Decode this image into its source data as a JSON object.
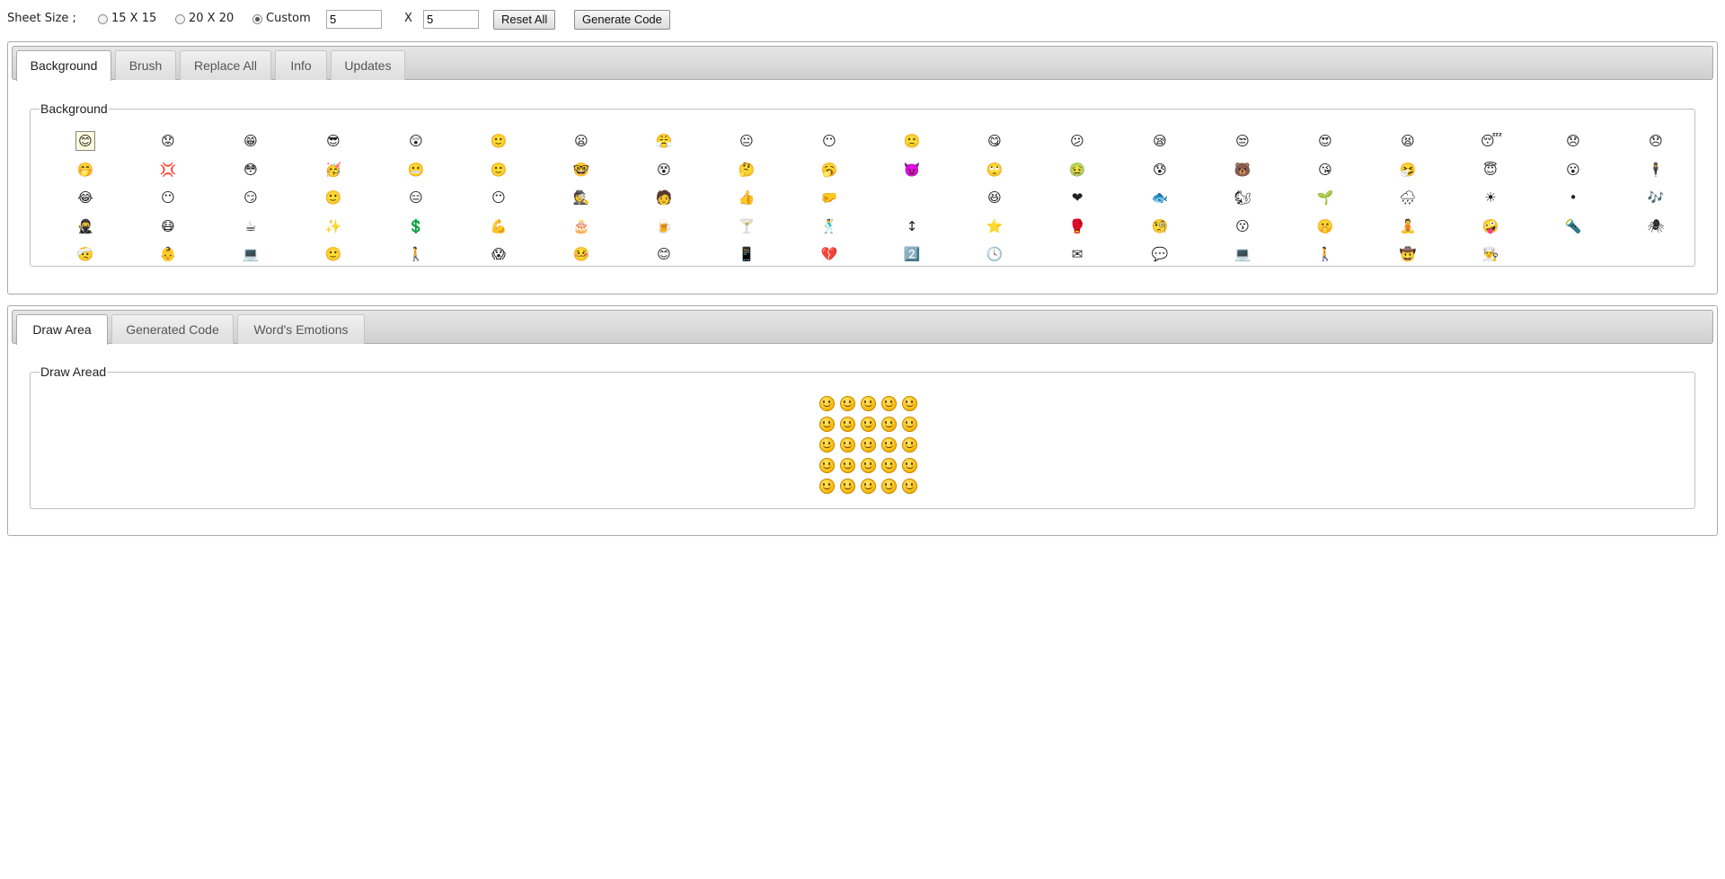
{
  "toolbar": {
    "sheet_size_label": "Sheet Size ;",
    "radio_15": "15 X 15",
    "radio_20": "20 X 20",
    "radio_custom": "Custom",
    "width_value": "5",
    "x_label": "X",
    "height_value": "5",
    "reset_label": "Reset All",
    "generate_label": "Generate Code",
    "selected_size": "Custom"
  },
  "top_panel": {
    "tabs": [
      {
        "label": "Background",
        "active": true
      },
      {
        "label": "Brush",
        "active": false
      },
      {
        "label": "Replace All",
        "active": false
      },
      {
        "label": "Info",
        "active": false
      },
      {
        "label": "Updates",
        "active": false
      }
    ],
    "fieldset_legend": "Background",
    "emoticons": [
      [
        "😊",
        "😟",
        "😁",
        "😎",
        "😲",
        "🙂",
        "😦",
        "😤",
        "😐",
        "😶",
        "🙁",
        "😋",
        "😕",
        "😪",
        "😒",
        "😍",
        "😫",
        "😴",
        "😞",
        "😞"
      ],
      [
        "🤭",
        "💢",
        "😳",
        "🥳",
        "😬",
        "🙂",
        "🤓",
        "😵",
        "🤔",
        "🥱",
        "👿",
        "🙄",
        "🤢",
        "😰",
        "🐻",
        "😘",
        "🤧",
        "😇",
        "😮",
        "🕴"
      ],
      [
        "😂",
        "😶",
        "😏",
        "🙂",
        "😑",
        "😶",
        "🕵",
        "🧑",
        "👍",
        "🤛",
        "",
        "😆",
        "❤",
        "🐟",
        "🐿",
        "🌱",
        "🌧",
        "☀",
        "•",
        "🎶"
      ],
      [
        "🥷",
        "😷",
        "☕",
        "✨",
        "💲",
        "💪",
        "🎂",
        "🍺",
        "🍸",
        "🕺",
        "↕",
        "⭐",
        "🥊",
        "🧐",
        "😗",
        "🤫",
        "🧘",
        "🤪",
        "🔦",
        "🕷"
      ],
      [
        "🤕",
        "👶",
        "💻",
        "🙂",
        "🚶",
        "😱",
        "🤒",
        "😊",
        "📱",
        "💔",
        "2️⃣",
        "🕓",
        "✉",
        "💬",
        "💻",
        "🚶",
        "🤠",
        "👨‍🍳"
      ]
    ]
  },
  "bottom_panel": {
    "tabs": [
      {
        "label": "Draw Area",
        "active": true
      },
      {
        "label": "Generated Code",
        "active": false
      },
      {
        "label": "Word's Emotions",
        "active": false
      }
    ],
    "fieldset_legend": "Draw Aread",
    "draw_grid": {
      "rows": 5,
      "cols": 5,
      "fill_icon": "smile-icon"
    }
  }
}
